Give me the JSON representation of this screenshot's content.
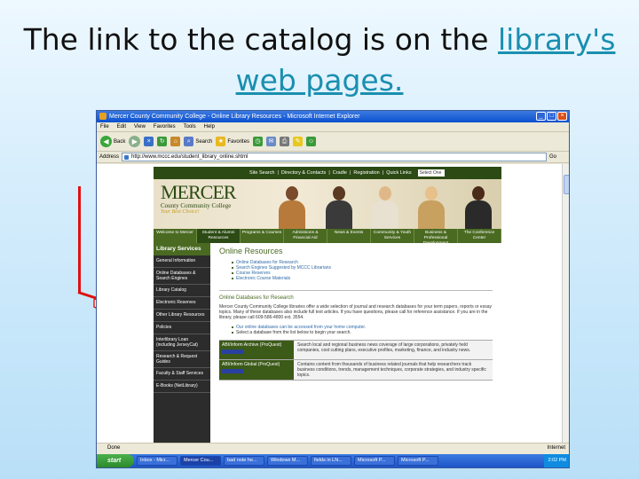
{
  "slide": {
    "title_pre": "The link to the catalog is on the ",
    "title_link": "library's web pages."
  },
  "browser": {
    "window_title": "Mercer County Community College - Online Library Resources - Microsoft Internet Explorer",
    "menu": [
      "File",
      "Edit",
      "View",
      "Favorites",
      "Tools",
      "Help"
    ],
    "toolbar": {
      "back": "Back",
      "search": "Search",
      "favorites": "Favorites"
    },
    "address_label": "Address",
    "address": "http://www.mccc.edu/student_library_online.shtml",
    "go": "Go",
    "status": "Done",
    "zone": "Internet"
  },
  "site": {
    "topnav": [
      "Site Search",
      "Directory & Contacts",
      "Cradle",
      "Registration",
      "Quick Links"
    ],
    "select": "Select One",
    "logo_big": "MERCER",
    "logo_sub": "County Community College",
    "logo_tag": "Your Best Choice!",
    "mainnav": [
      "Welcome to Mercer",
      "Student & Alumni Resources",
      "Programs & Courses",
      "Admissions & Financial Aid",
      "News & Events",
      "Community & Youth Services",
      "Business & Professional Development",
      "The Conference Center"
    ],
    "leftnav_title": "Library Services",
    "leftnav": [
      "General Information",
      "Online Databases & Search Engines",
      "Library Catalog",
      "Electronic Reserves",
      "Other Library Resources",
      "Policies",
      "Interlibrary Loan (including JerseyCat)",
      "Research & Request Guides",
      "Faculty & Staff Services",
      "E-Books (NetLibrary)"
    ],
    "heading": "Online Resources",
    "links": [
      "Online Databases for Research",
      "Search Engines Suggested by MCCC Librarians",
      "Course Reserves",
      "Electronic Course Materials"
    ],
    "heading2": "Online Databases for Research",
    "para": "Mercer County Community College libraries offer a wide selection of journal and research databases for your term papers, reports or essay topics. Many of these databases also include full text articles. If you have questions, please call for reference assistance. If you are in the library, please call 609-586-4800 ext. 3554.",
    "bullets": [
      "Our online databases can be accessed from your home computer.",
      "Select a database from the list below to begin your search."
    ],
    "databases": [
      {
        "name": "ABI/Inform Archive (ProQuest)",
        "desc": "Search local and regional business news coverage of large corporations, privately held companies, cost cutting plans, executive profiles, marketing, finance, and industry news."
      },
      {
        "name": "ABI/Inform Global (ProQuest)",
        "desc": "Contains content from thousands of business related journals that help researchers track business conditions, trends, management techniques, corporate strategies, and industry specific topics."
      }
    ]
  },
  "taskbar": {
    "start": "start",
    "tasks": [
      "Inbox - Micr...",
      "Mercer Cou...",
      "bad note he...",
      "Windows M...",
      "fields in LN...",
      "Microsoft P...",
      "Microsoft P..."
    ],
    "clock": "2:02 PM"
  }
}
